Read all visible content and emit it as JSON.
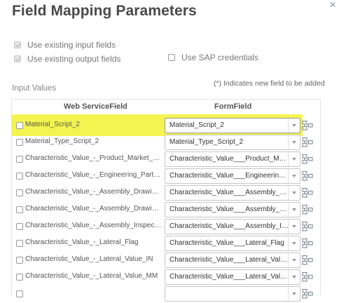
{
  "dialog": {
    "title": "Field Mapping Parameters",
    "close_icon": "close-icon",
    "close_glyph": "×"
  },
  "options": {
    "use_existing_input": {
      "label": "Use existing input fields",
      "checked": true,
      "disabled": true
    },
    "use_existing_output": {
      "label": "Use existing output fields",
      "checked": true,
      "disabled": true
    },
    "use_sap_credentials": {
      "label": "Use SAP credentials",
      "checked": false,
      "disabled": false
    }
  },
  "input_values": {
    "label": "Input Values",
    "note": "(*) Indicates new field to be added",
    "columns": {
      "web_service_field": "Web ServiceField",
      "form_field": "FormField"
    },
    "rows": [
      {
        "web_service_field": "Material_Script_2",
        "form_field": "Material_Script_2",
        "highlighted": true
      },
      {
        "web_service_field": "Material_Type_Script_2",
        "form_field": "Material_Type_Script_2"
      },
      {
        "web_service_field": "Characteristic_Value_-_Product_Market_Category",
        "form_field": "Characteristic_Value___Product_Market_Category"
      },
      {
        "web_service_field": "Characteristic_Value_-_Engineering_Part_Number",
        "form_field": "Characteristic_Value___Engineering_Part_Number"
      },
      {
        "web_service_field": "Characteristic_Value_-_Assembly_Drawing_Number",
        "form_field": "Characteristic_Value___Assembly_Drawing_Number"
      },
      {
        "web_service_field": "Characteristic_Value_-_Assembly_Drawing_Revision",
        "form_field": "Characteristic_Value___Assembly_Drawing_Revision"
      },
      {
        "web_service_field": "Characteristic_Value_-_Assembly_Inspection_Plan",
        "form_field": "Characteristic_Value___Assembly_Inspection_Plan"
      },
      {
        "web_service_field": "Characteristic_Value_-_Lateral_Flag",
        "form_field": "Characteristic_Value___Lateral_Flag"
      },
      {
        "web_service_field": "Characteristic_Value_-_Lateral_Value_IN",
        "form_field": "Characteristic_Value___Lateral_Value_IN"
      },
      {
        "web_service_field": "Characteristic_Value_-_Lateral_Value_MM",
        "form_field": "Characteristic_Value___Lateral_Value_MM"
      },
      {
        "web_service_field": "",
        "form_field": ""
      }
    ],
    "row_icons": {
      "checkbox": "row-checkbox",
      "dropdown": "chevron-down-icon",
      "map": "field-map-icon"
    },
    "colors": {
      "highlight": "#f4f451",
      "text": "#555555",
      "border": "#dfe3e6",
      "icon": "#7d8893"
    }
  }
}
